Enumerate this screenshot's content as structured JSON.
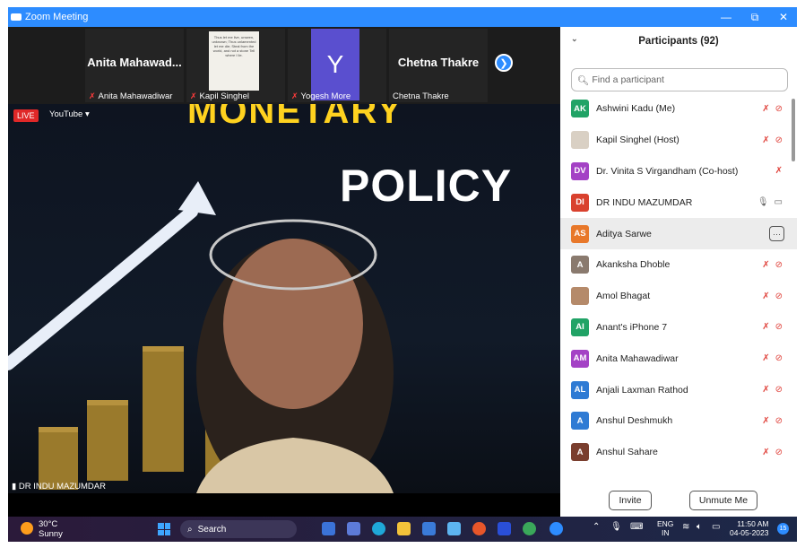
{
  "window": {
    "title": "Zoom Meeting",
    "controls": {
      "minimize": "—",
      "restore": "⧉",
      "close": "✕"
    }
  },
  "thumbnails": [
    {
      "big_name": "Anita  Mahawad...",
      "label": "Anita Mahawadiwar",
      "muted": true
    },
    {
      "label": "Kapil Singhel",
      "muted": true,
      "doc_text": "Thus let me live, unseen, unknown; Thus unlamented let me die; Steal from the world, and not a stone Tell where I lie."
    },
    {
      "avatar_letter": "Y",
      "avatar_color": "#5a4fcf",
      "label": "Yogesh More",
      "muted": true
    },
    {
      "big_name": "Chetna Thakre",
      "label": "Chetna Thakre",
      "muted": false
    }
  ],
  "stage": {
    "live_label": "LIVE",
    "stream_label": "YouTube ▾",
    "slide_text_top": "MONETARY",
    "slide_text_main": "POLICY",
    "speaker": "DR INDU MAZUMDAR"
  },
  "participants_panel": {
    "title": "Participants (92)",
    "search_placeholder": "Find a participant",
    "invite_label": "Invite",
    "unmute_label": "Unmute Me",
    "rows": [
      {
        "initials": "AK",
        "color": "#21a366",
        "name": "Ashwini Kadu (Me)",
        "mic": "muted",
        "video": "off"
      },
      {
        "initials": "",
        "color": "#d9d0c4",
        "name": "Kapil Singhel (Host)",
        "mic": "muted",
        "video": "off",
        "photo": true
      },
      {
        "initials": "DV",
        "color": "#a442c5",
        "name": "Dr. Vinita  S Virgandham (Co-host)",
        "mic": "muted",
        "video": "none"
      },
      {
        "initials": "DI",
        "color": "#d9412e",
        "name": "DR INDU MAZUMDAR",
        "mic": "on",
        "video": "on"
      },
      {
        "initials": "AS",
        "color": "#e8782a",
        "name": "Aditya Sarwe",
        "mic": "more",
        "video": "none",
        "highlight": true
      },
      {
        "initials": "A",
        "color": "#8a7a6e",
        "name": "Akanksha Dhoble",
        "mic": "muted",
        "video": "off"
      },
      {
        "initials": "",
        "color": "#b58a6a",
        "name": "Amol Bhagat",
        "mic": "muted",
        "video": "off",
        "photo": true
      },
      {
        "initials": "AI",
        "color": "#21a366",
        "name": "Anant's iPhone 7",
        "mic": "muted",
        "video": "off"
      },
      {
        "initials": "AM",
        "color": "#a442c5",
        "name": "Anita Mahawadiwar",
        "mic": "muted",
        "video": "off"
      },
      {
        "initials": "AL",
        "color": "#2f7bd4",
        "name": "Anjali Laxman Rathod",
        "mic": "muted",
        "video": "off"
      },
      {
        "initials": "A",
        "color": "#2f7bd4",
        "name": "Anshul Deshmukh",
        "mic": "muted",
        "video": "off"
      },
      {
        "initials": "A",
        "color": "#7a3e2e",
        "name": "Anshul Sahare",
        "mic": "muted",
        "video": "off"
      }
    ]
  },
  "taskbar": {
    "temperature": "30°C",
    "weather": "Sunny",
    "search_label": "Search",
    "lang_top": "ENG",
    "lang_bottom": "IN",
    "time": "11:50 AM",
    "date": "04-05-2023",
    "notification_count": "15"
  }
}
